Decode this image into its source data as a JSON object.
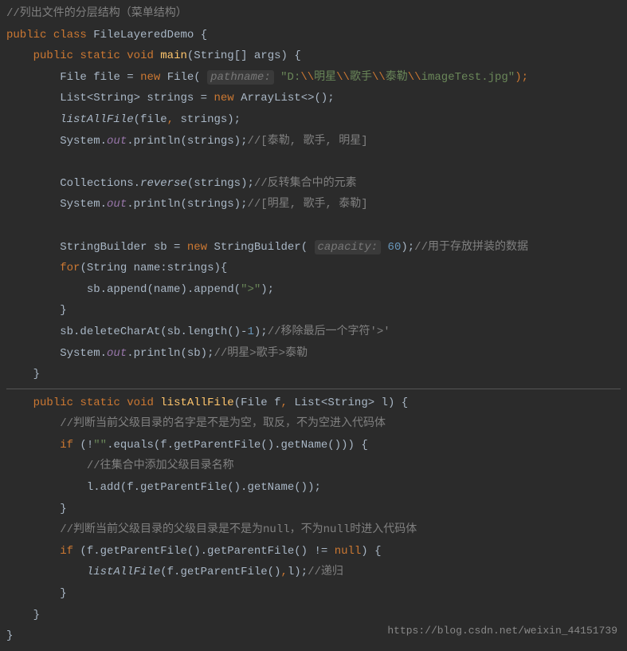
{
  "code": {
    "comment_top": "//列出文件的分层结构（菜单结构）",
    "kw_public": "public",
    "kw_class": "class",
    "class_name": "FileLayeredDemo",
    "brace_open": "{",
    "brace_close": "}",
    "kw_static": "static",
    "kw_void": "void",
    "method_main": "main",
    "main_params": "(String[] args) {",
    "type_file": "File",
    "var_file": "file",
    "eq": " = ",
    "kw_new": "new",
    "file_ctor": "File(",
    "hint_pathname": "pathname:",
    "path_start": " \"D:",
    "esc": "\\\\",
    "path_p1": "明星",
    "path_p2": "歌手",
    "path_p3": "泰勒",
    "path_p4": "imageTest.jpg\"",
    "close_paren_semi": ");",
    "list_decl": "List<String> strings = ",
    "arraylist": "ArrayList<>();",
    "listallfile_call": "listAllFile",
    "listall_args": "(file",
    "comma": ",",
    "listall_args2": " strings);",
    "sysout": "System.",
    "out_field": "out",
    "println_call": ".println(strings);",
    "comment_result1": "//[泰勒, 歌手, 明星]",
    "collections": "Collections.",
    "reverse_call": "reverse",
    "reverse_args": "(strings);",
    "comment_reverse": "//反转集合中的元素",
    "comment_result2": "//[明星, 歌手, 泰勒]",
    "sb_decl": "StringBuilder sb = ",
    "sb_ctor": "StringBuilder(",
    "hint_capacity": "capacity:",
    "sb_cap": " 60",
    "sb_close": ");",
    "comment_sb": "//用于存放拼装的数据",
    "kw_for": "for",
    "for_head": "(String name:strings){",
    "sb_append": "sb.append(name).append(",
    "gt_str": "\">\"",
    "sb_append_end": ");",
    "sb_delete": "sb.deleteCharAt(sb.length()-",
    "num_1": "1",
    "sb_delete_end": ");",
    "comment_delete": "//移除最后一个字符'>'",
    "println_sb": ".println(sb);",
    "comment_final": "//明星>歌手>泰勒",
    "method_listall": "listAllFile",
    "listall_params": "(File f",
    "listall_params2": " List<String> l) {",
    "comment_parent1": "//判断当前父级目录的名字是不是为空，取反，不为空进入代码体",
    "kw_if": "if",
    "if_cond1": " (!",
    "empty_str": "\"\"",
    "if_cond1b": ".equals(f.getParentFile().getName())) {",
    "comment_add": "//往集合中添加父级目录名称",
    "l_add": "l.add(f.getParentFile().getName());",
    "comment_parent2": "//判断当前父级目录的父级目录是不是为null，不为null时进入代码体",
    "if_cond2": " (f.getParentFile().getParentFile() != ",
    "kw_null": "null",
    "if_cond2b": ") {",
    "recurse_args": "(f.getParentFile()",
    "recurse_args2": "l);",
    "comment_recurse": "//递归"
  },
  "watermark": "https://blog.csdn.net/weixin_44151739"
}
